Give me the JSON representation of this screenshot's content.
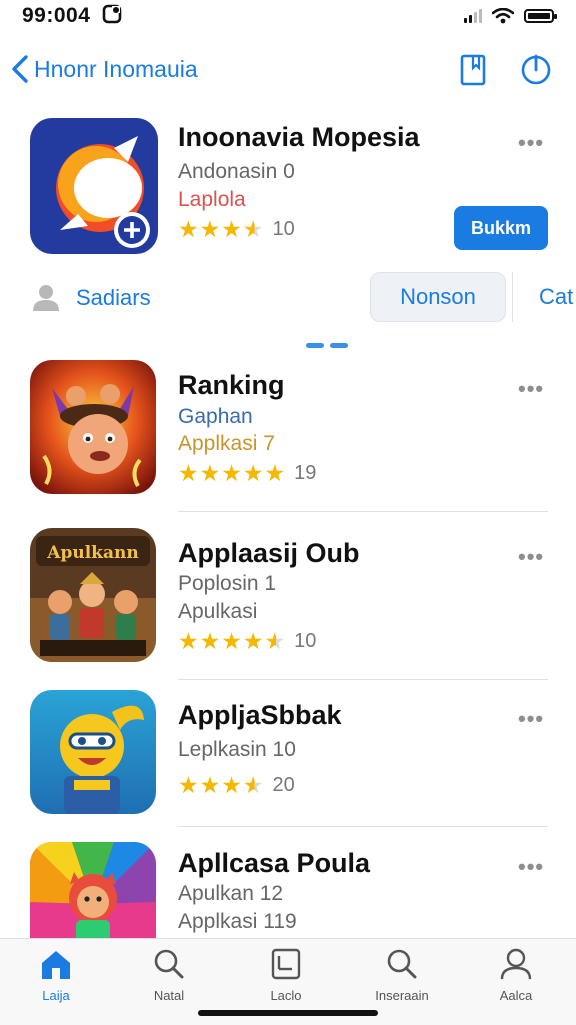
{
  "status_bar": {
    "time": "99:004"
  },
  "nav": {
    "back_label": "Hnonr Inomauia"
  },
  "featured": {
    "title": "Inoonavia Mopesia",
    "subtitle": "Andonasin  0",
    "category": "Laplola",
    "rating_count": "10",
    "rating": 3.5,
    "get_button": "Bukkm"
  },
  "segments": {
    "profile_label": "Sadiars",
    "tab_active": "Nonson",
    "tab_next": "Cat"
  },
  "list": [
    {
      "title": "Ranking",
      "line1": "Gaphan",
      "line2": "Applkasi 7",
      "rating_count": "19",
      "rating": 5
    },
    {
      "title": "Applaasij Oub",
      "line1": "Poplosin 1",
      "line2": "Apulkasi",
      "rating_count": "10",
      "rating": 4.5
    },
    {
      "title": "AppljaSbbak",
      "line1": "Leplkasin 10",
      "rating_count": "20",
      "rating": 3.5
    },
    {
      "title": "Apllcasa Poula",
      "line1": "Apulkan 12",
      "line2": "Applkasi 119"
    }
  ],
  "icon_art": {
    "app2_text": "Apulkann"
  },
  "tabbar": {
    "tabs": [
      {
        "label": "Laija",
        "icon": "home-icon"
      },
      {
        "label": "Natal",
        "icon": "search-icon"
      },
      {
        "label": "Laclo",
        "icon": "calendar-icon"
      },
      {
        "label": "Inseraain",
        "icon": "search-icon"
      },
      {
        "label": "Aalca",
        "icon": "person-icon"
      }
    ]
  },
  "colors": {
    "accent": "#1a7be0",
    "star": "#f5b800",
    "category_red": "#d9534f",
    "category_gold": "#c9952a"
  }
}
